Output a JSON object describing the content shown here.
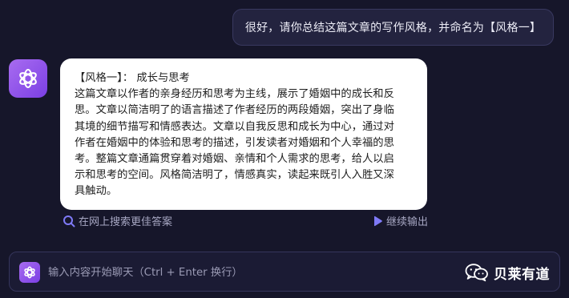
{
  "user_message": {
    "text": "很好，请你总结这篇文章的写作风格，并命名为【风格一】"
  },
  "assistant_message": {
    "lines": [
      "【风格一】： 成长与思考",
      "这篇文章以作者的亲身经历和思考为主线，展示了婚姻中的成长和反",
      "思。文章以简洁明了的语言描述了作者经历的两段婚姻，突出了身临",
      "其境的细节描写和情感表达。文章以自我反思和成长为中心，通过对",
      "作者在婚姻中的体验和思考的描述，引发读者对婚姻和个人幸福的思",
      "考。整篇文章通篇贯穿着对婚姻、亲情和个人需求的思考，给人以启",
      "示和思考的空间。风格简洁明了，情感真实，读起来既引人入胜又深",
      "具触动。"
    ]
  },
  "actions": {
    "search_label": "在网上搜索更佳答案",
    "search_icon": "search-icon",
    "continue_label": "继续输出",
    "continue_icon": "play-icon"
  },
  "input": {
    "placeholder": "输入内容开始聊天（Ctrl + Enter 换行）",
    "value": ""
  },
  "watermark": {
    "text": "贝莱有道",
    "icon": "wechat-icon"
  },
  "colors": {
    "background": "#16162a",
    "accent": "#8b50ec",
    "user_bubble": "#23233f",
    "assistant_bubble": "#ffffff"
  }
}
